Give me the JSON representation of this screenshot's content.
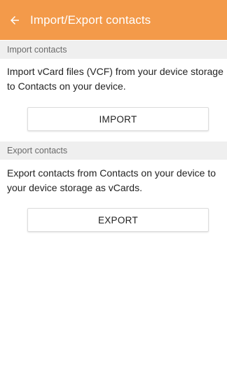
{
  "app_bar": {
    "title": "Import/Export contacts",
    "back_icon": "arrow-left-icon",
    "color": "#f39a4a"
  },
  "import_section": {
    "header": "Import contacts",
    "description": "Import vCard files (VCF) from your device storage to Contacts on your device.",
    "button_label": "IMPORT"
  },
  "export_section": {
    "header": "Export contacts",
    "description": "Export contacts from Contacts on your device to your device storage as vCards.",
    "button_label": "EXPORT"
  }
}
